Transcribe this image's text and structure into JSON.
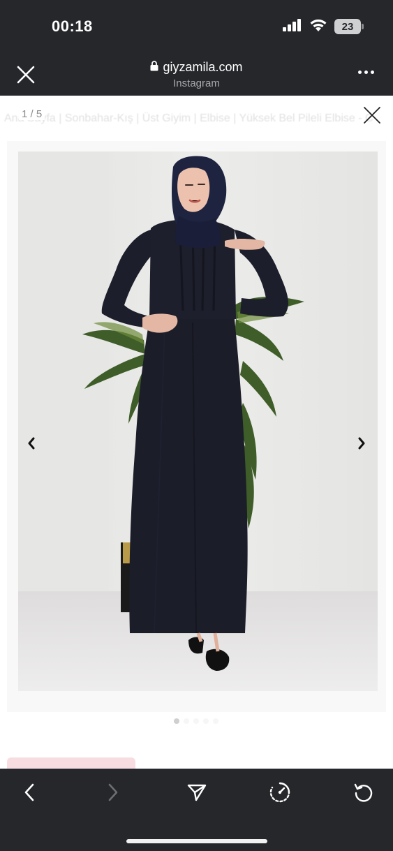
{
  "status_bar": {
    "time": "00:18",
    "battery": "23",
    "icons": [
      "cellular-signal-icon",
      "wifi-icon",
      "battery-icon"
    ]
  },
  "browser": {
    "domain": "giyzamila.com",
    "source": "Instagram",
    "icons": [
      "close-icon",
      "lock-icon",
      "more-options-icon"
    ]
  },
  "page": {
    "breadcrumb": "Ana Sayfa  |  Sonbahar-Kış  |  Üst Giyim  |  Elbise  |  Yüksek Bel Pileli Elbise - C",
    "gallery": {
      "counter": "1 / 5",
      "total_dots": 5,
      "active_dot": 1,
      "image_description_icon": "product-photo",
      "icons": [
        "lightbox-close-icon",
        "chevron-left-icon",
        "chevron-right-icon"
      ]
    }
  },
  "toolbar": {
    "icons": [
      "back-icon",
      "forward-icon",
      "share-icon",
      "speed-icon",
      "reload-icon"
    ],
    "forward_enabled": false
  },
  "colors": {
    "chrome_bg": "#25272b",
    "dress": "#1b1d29",
    "hijab": "#1e2340",
    "backdrop": "#e8e8e6",
    "promo_pink": "#f7dde2"
  }
}
